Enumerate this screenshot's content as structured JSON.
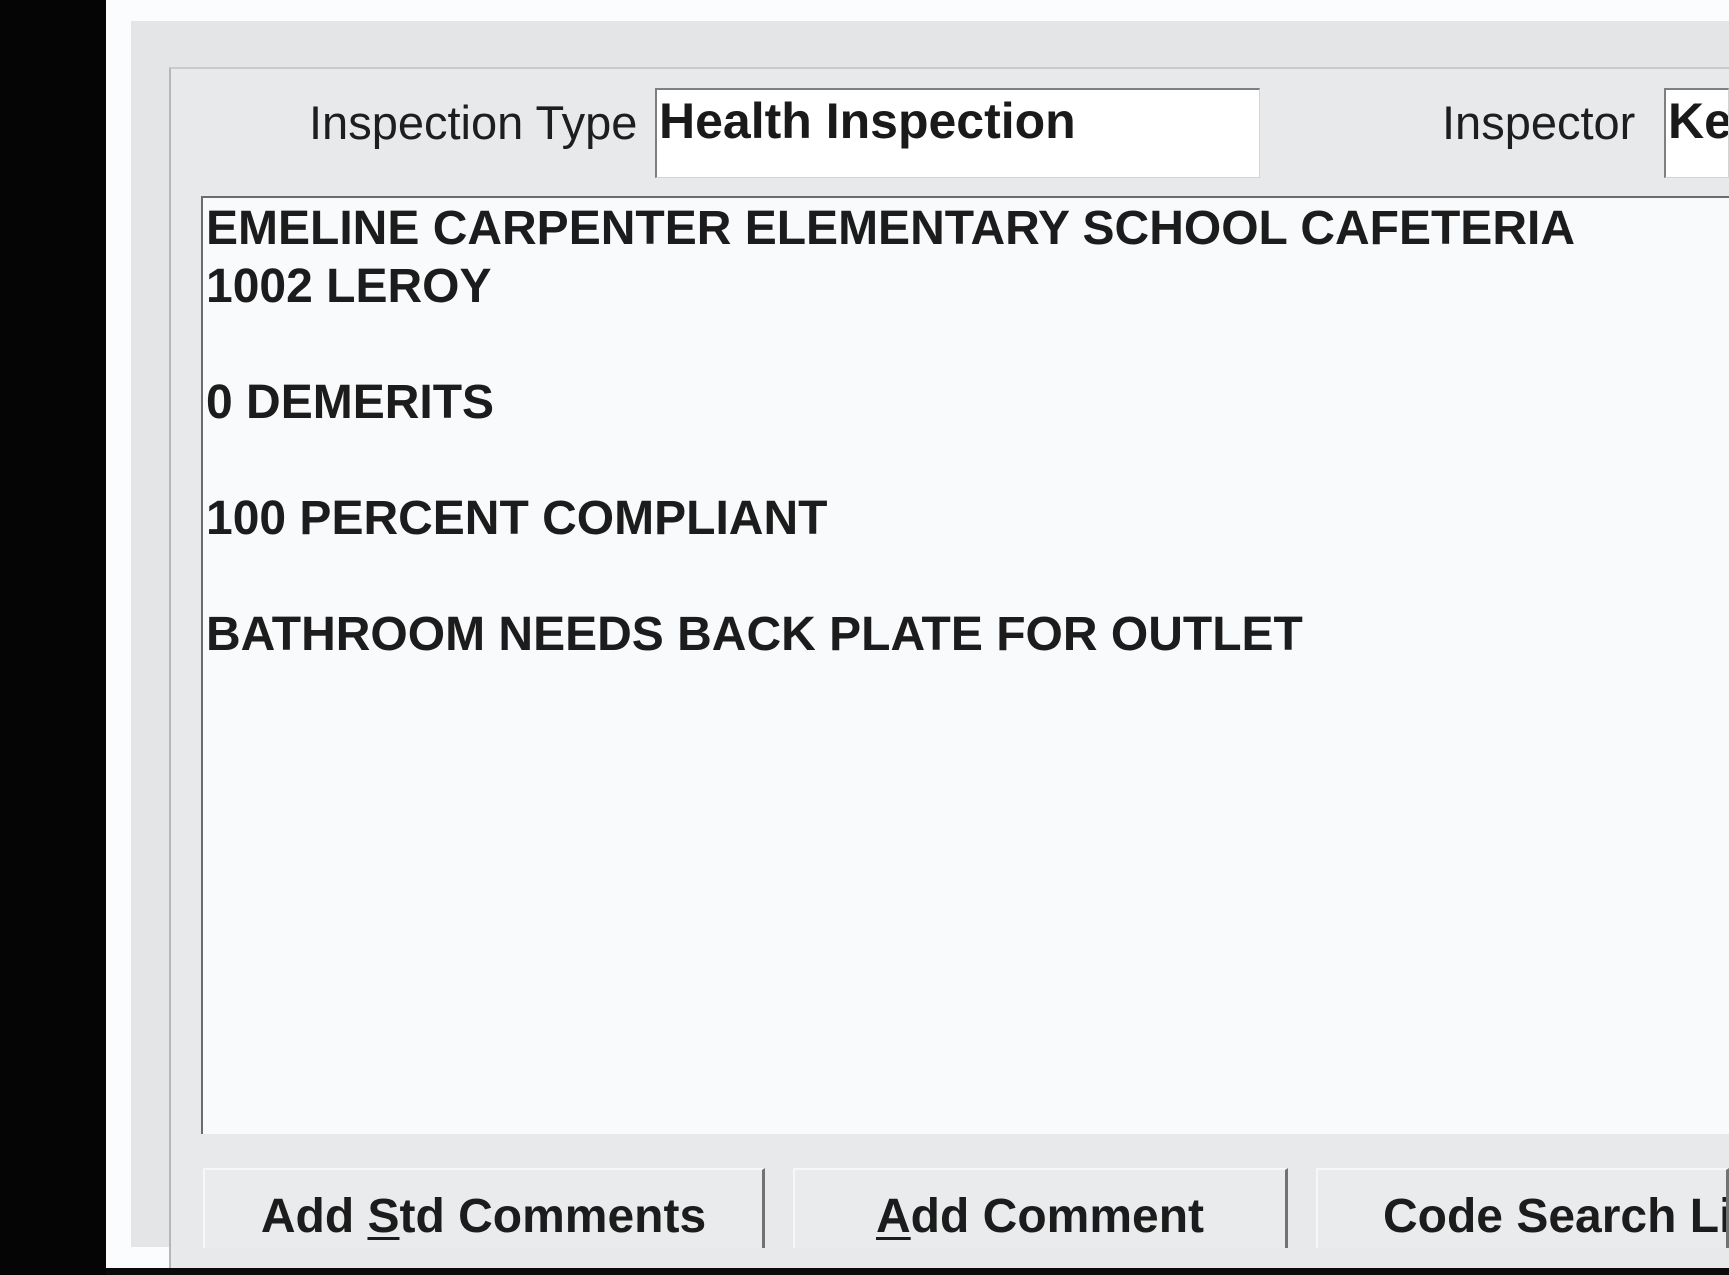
{
  "inspection_type": {
    "label": "Inspection Type",
    "value": "Health Inspection"
  },
  "inspector": {
    "label": "Inspector",
    "value": "Ke"
  },
  "comments": {
    "lines": [
      "EMELINE CARPENTER ELEMENTARY SCHOOL CAFETERIA",
      "1002 LEROY",
      "",
      "0 DEMERITS",
      "",
      "100 PERCENT COMPLIANT",
      "",
      "BATHROOM NEEDS BACK PLATE FOR OUTLET"
    ]
  },
  "buttons": {
    "add_std_comments": {
      "before": "Add ",
      "mnemonic": "S",
      "after": "td Comments"
    },
    "add_comment": {
      "before": "",
      "mnemonic": "A",
      "after": "dd Comment"
    },
    "code_search": {
      "label": "Code Search Li"
    }
  },
  "colors": {
    "window_background": "#e7e9eb",
    "field_background": "#ffffff",
    "text": "#1c1c1c",
    "scan_border": "#050505"
  }
}
